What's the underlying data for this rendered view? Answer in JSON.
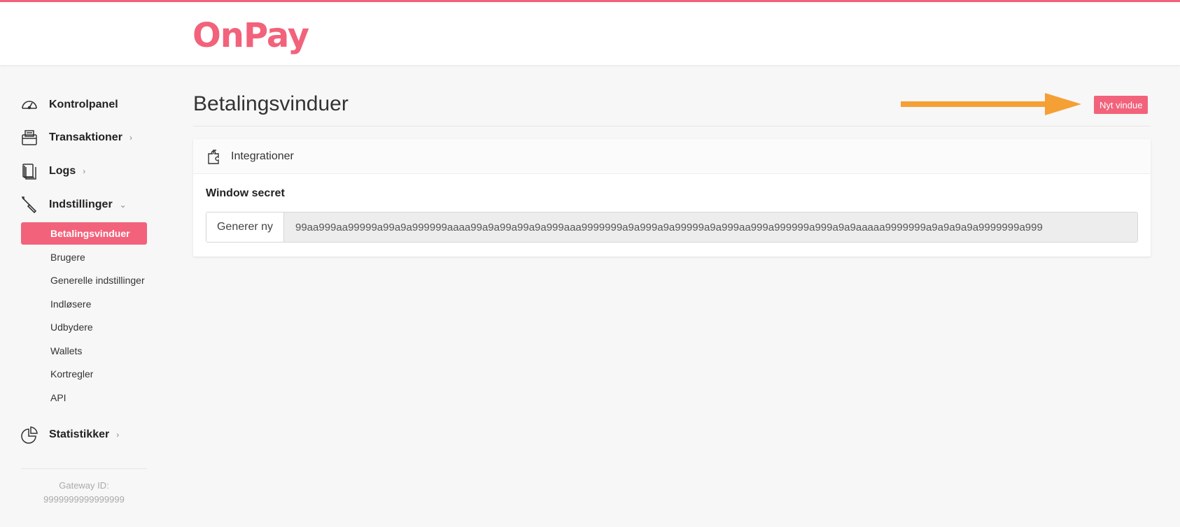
{
  "brand": {
    "logo_text": "OnPay",
    "accent": "#f2627b"
  },
  "sidebar": {
    "main_items": [
      {
        "label": "Kontrolpanel",
        "icon": "dashboard-gauge-icon",
        "has_chevron": false
      },
      {
        "label": "Transaktioner",
        "icon": "payment-terminal-icon",
        "chevron": "›"
      },
      {
        "label": "Logs",
        "icon": "documents-icon",
        "chevron": "›"
      },
      {
        "label": "Indstillinger",
        "icon": "screwdriver-icon",
        "chevron": "⌄"
      },
      {
        "label": "Statistikker",
        "icon": "pie-chart-icon",
        "chevron": "›"
      }
    ],
    "sub_items": [
      {
        "label": "Betalingsvinduer",
        "active": true
      },
      {
        "label": "Brugere"
      },
      {
        "label": "Generelle indstillinger"
      },
      {
        "label": "Indløsere"
      },
      {
        "label": "Udbydere"
      },
      {
        "label": "Wallets"
      },
      {
        "label": "Kortregler"
      },
      {
        "label": "API"
      }
    ],
    "gateway_label": "Gateway ID:",
    "gateway_id": "9999999999999999"
  },
  "main": {
    "page_title": "Betalingsvinduer",
    "new_window_button": "Nyt vindue",
    "arrow_color": "#f5a035",
    "panel": {
      "title": "Integrationer",
      "icon": "puzzle-piece-icon",
      "field_label": "Window secret",
      "generate_button": "Generer ny",
      "secret_value": "99aa999aa99999a99a9a999999aaaa99a9a99a99a9a999aaa9999999a9a999a9a99999a9a999aa999a999999a999a9a9aaaaa9999999a9a9a9a9a9999999a999"
    }
  }
}
